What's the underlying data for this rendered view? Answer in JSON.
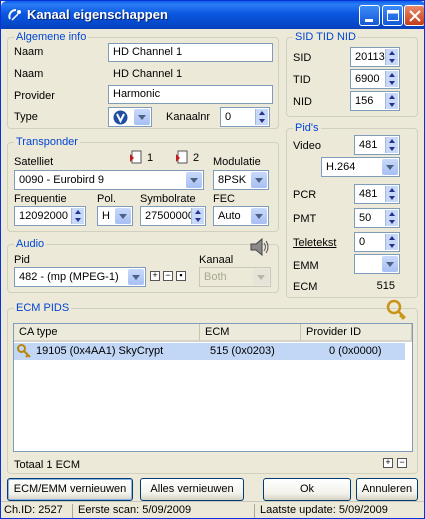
{
  "window": {
    "title": "Kanaal eigenschappen"
  },
  "algemene": {
    "group_label": "Algemene info",
    "naam_label": "Naam",
    "naam_value": "HD Channel 1",
    "naam2_label": "Naam",
    "naam2_value": "HD Channel 1",
    "provider_label": "Provider",
    "provider_value": "Harmonic",
    "type_label": "Type",
    "kanaalnr_label": "Kanaalnr",
    "kanaalnr_value": "0"
  },
  "sid": {
    "group_label": "SID TID NID",
    "sid_label": "SID",
    "sid_value": "20113",
    "tid_label": "TID",
    "tid_value": "6900",
    "nid_label": "NID",
    "nid_value": "156"
  },
  "transponder": {
    "group_label": "Transponder",
    "satelliet_label": "Satelliet",
    "satelliet_value": "0090 - Eurobird 9",
    "marker1": "1",
    "marker2": "2",
    "modulatie_label": "Modulatie",
    "modulatie_value": "8PSK",
    "frequentie_label": "Frequentie",
    "frequentie_value": "12092000",
    "pol_label": "Pol.",
    "pol_value": "H",
    "symbolrate_label": "Symbolrate",
    "symbolrate_value": "27500000",
    "fec_label": "FEC",
    "fec_value": "Auto"
  },
  "pids": {
    "group_label": "Pid's",
    "video_label": "Video",
    "video_value": "481",
    "video_codec": "H.264",
    "pcr_label": "PCR",
    "pcr_value": "481",
    "pmt_label": "PMT",
    "pmt_value": "50",
    "teletekst_label": "Teletekst",
    "teletekst_value": "0",
    "emm_label": "EMM",
    "emm_value": "",
    "ecm_label": "ECM",
    "ecm_value": "515"
  },
  "audio": {
    "group_label": "Audio",
    "pid_label": "Pid",
    "pid_value": "482 - (mp (MPEG-1)",
    "kanaal_label": "Kanaal",
    "kanaal_value": "Both"
  },
  "ecm": {
    "group_label": "ECM PIDS",
    "columns": [
      "CA type",
      "ECM",
      "Provider ID"
    ],
    "rows": [
      {
        "ca_type": "19105  (0x4AA1) SkyCrypt",
        "ecm": "515  (0x0203)",
        "provider": "0  (0x0000)"
      }
    ],
    "total": "Totaal 1 ECM"
  },
  "buttons": {
    "ecm_emm": "ECM/EMM vernieuwen",
    "alles": "Alles vernieuwen",
    "ok": "Ok",
    "annuleren": "Annuleren"
  },
  "status": {
    "chid": "Ch.ID: 2527",
    "eerste": "Eerste scan: 5/09/2009",
    "laatste": "Laatste update: 5/09/2009"
  },
  "colors": {
    "title_bar": "#0a5fe8",
    "group_label": "#0046d5",
    "selected_row": "#c2d6f5"
  }
}
